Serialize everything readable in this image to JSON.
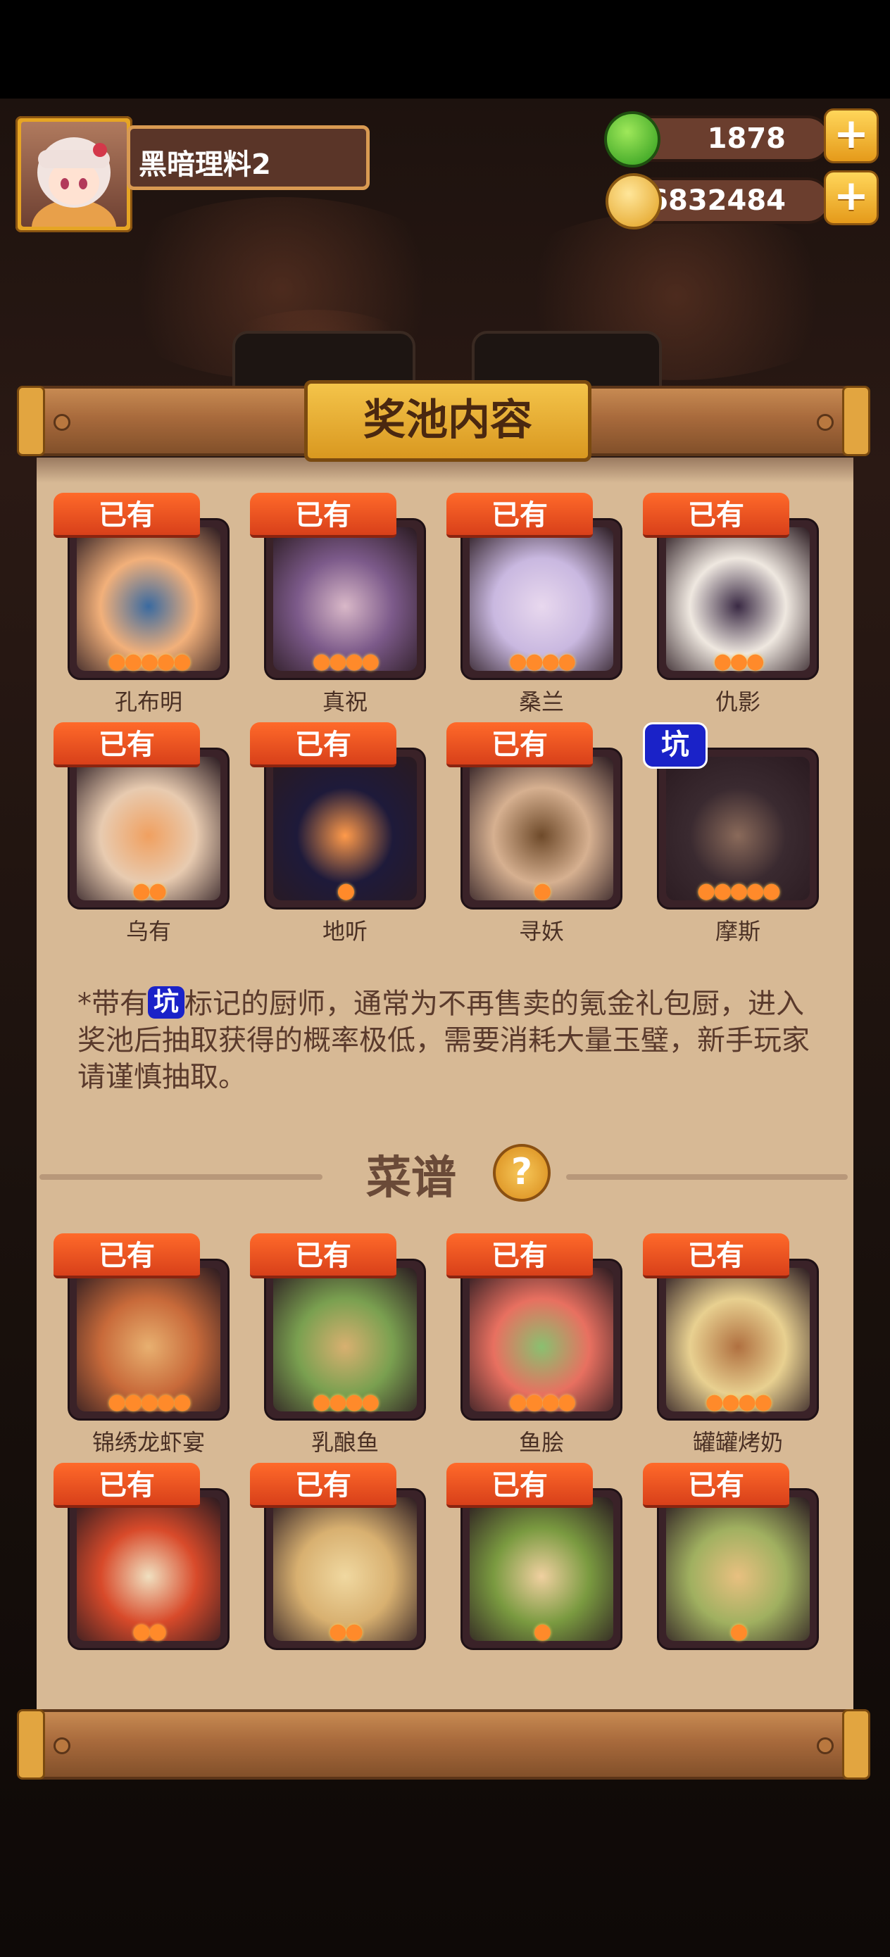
{
  "player": {
    "name": "黑暗理料2"
  },
  "resources": {
    "jade": {
      "value": "1878",
      "icon": "green-jade-icon"
    },
    "coins": {
      "value": "16832484",
      "icon": "gold-coin-icon"
    },
    "plus_label": "+"
  },
  "panel": {
    "title": "奖池内容"
  },
  "owned_label": "已有",
  "pit_label": "坑",
  "chefs": [
    {
      "name": "孔布明",
      "badge": "owned",
      "stars": 5
    },
    {
      "name": "真祝",
      "badge": "owned",
      "stars": 4
    },
    {
      "name": "桑兰",
      "badge": "owned",
      "stars": 4
    },
    {
      "name": "仇影",
      "badge": "owned",
      "stars": 3
    },
    {
      "name": "乌有",
      "badge": "owned",
      "stars": 2
    },
    {
      "name": "地听",
      "badge": "owned",
      "stars": 1
    },
    {
      "name": "寻妖",
      "badge": "owned",
      "stars": 1
    },
    {
      "name": "摩斯",
      "badge": "pit",
      "stars": 5
    }
  ],
  "note": {
    "prefix": "*带有",
    "suffix": "标记的厨师，通常为不再售卖的氪金礼包厨，进入奖池后抽取获得的概率极低，需要消耗大量玉璧，新手玩家请谨慎抽取。"
  },
  "recipes_section": {
    "title": "菜谱",
    "help_label": "?"
  },
  "recipes": [
    {
      "name": "锦绣龙虾宴",
      "badge": "owned",
      "stars": 5
    },
    {
      "name": "乳酿鱼",
      "badge": "owned",
      "stars": 4
    },
    {
      "name": "鱼脍",
      "badge": "owned",
      "stars": 4
    },
    {
      "name": "罐罐烤奶",
      "badge": "owned",
      "stars": 4
    },
    {
      "name": "",
      "badge": "owned",
      "stars": 2
    },
    {
      "name": "",
      "badge": "owned",
      "stars": 2
    },
    {
      "name": "",
      "badge": "owned",
      "stars": 1
    },
    {
      "name": "",
      "badge": "owned",
      "stars": 1
    }
  ],
  "colors": {
    "owned_badge": "#e2501e",
    "pit_badge": "#1a22c8",
    "paper": "#d7b995",
    "title_plate": "#f0b83a"
  }
}
